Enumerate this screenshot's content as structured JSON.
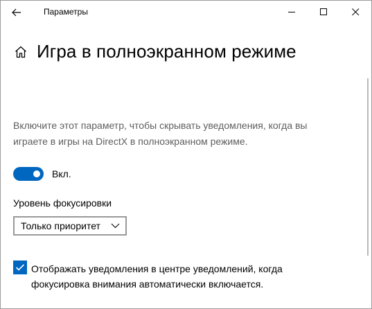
{
  "window": {
    "title": "Параметры",
    "back_icon": "back-arrow-icon",
    "minimize_icon": "minimize-icon",
    "maximize_icon": "maximize-icon",
    "close_icon": "close-icon"
  },
  "page": {
    "home_icon": "home-icon",
    "title": "Игра в полноэкранном режиме",
    "description": "Включите этот параметр, чтобы скрывать уведомления, когда вы играете в игры на DirectX в полноэкранном режиме."
  },
  "toggle": {
    "state": "on",
    "label": "Вкл.",
    "accent": "#0067c0"
  },
  "focus": {
    "label": "Уровень фокусировки",
    "selected": "Только приоритет",
    "chevron_icon": "chevron-down-icon"
  },
  "notification_option": {
    "checked": true,
    "label": "Отображать уведомления в центре уведомлений, когда фокусировка внимания автоматически включается."
  }
}
